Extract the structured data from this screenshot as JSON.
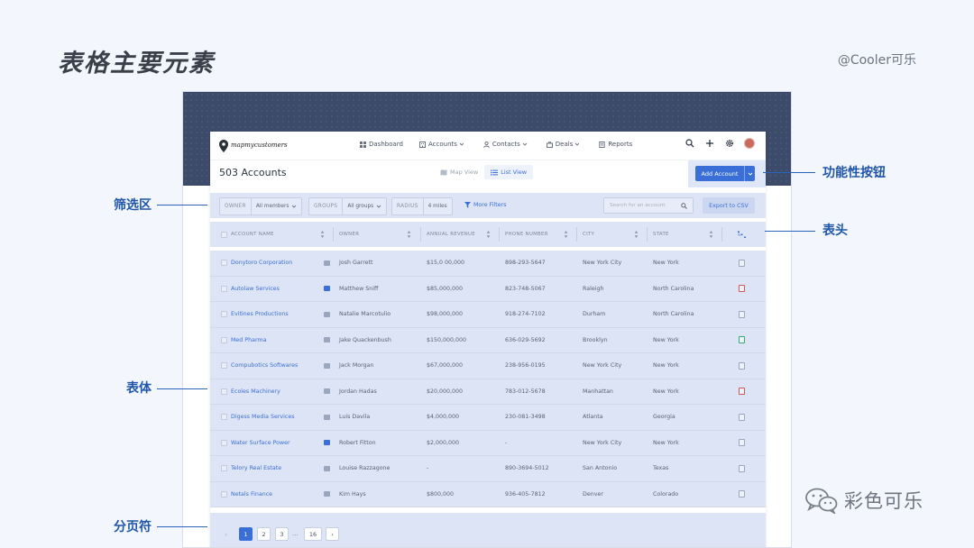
{
  "slide": {
    "title": "表格主要元素",
    "credit": "@Cooler可乐",
    "watermark": "彩色可乐"
  },
  "annotations": {
    "function_buttons": "功能性按钮",
    "filter_area": "筛选区",
    "table_header": "表头",
    "table_body": "表体",
    "pagination": "分页符"
  },
  "app": {
    "logo_text": "mapmycustomers",
    "nav": [
      {
        "label": "Dashboard",
        "icon": "dashboard-icon"
      },
      {
        "label": "Accounts",
        "icon": "building-icon",
        "dropdown": true
      },
      {
        "label": "Contacts",
        "icon": "person-icon",
        "dropdown": true
      },
      {
        "label": "Deals",
        "icon": "briefcase-icon",
        "dropdown": true
      },
      {
        "label": "Reports",
        "icon": "report-icon"
      }
    ],
    "page_title": "503 Accounts",
    "view_toggle": {
      "map": "Map View",
      "list": "List View",
      "active": "list"
    },
    "add_button": "Add Account",
    "accent": "#3b6fd8"
  },
  "filters": {
    "owner": {
      "label": "OWNER",
      "value": "All members"
    },
    "groups": {
      "label": "GROUPS",
      "value": "All groups"
    },
    "radius": {
      "label": "RADIUS",
      "value": "4 miles"
    },
    "more": "More Filters",
    "search_placeholder": "Search for an account",
    "export": "Export to CSV"
  },
  "table": {
    "columns": [
      "ACCOUNT NAME",
      "OWNER",
      "ANNUAL REVENUE",
      "PHONE NUMBER",
      "CITY",
      "STATE"
    ],
    "rows": [
      {
        "name": "Donytoro Corporation",
        "owner": "Josh Garrett",
        "revenue": "$15,0 00,000",
        "phone": "898-293-5647",
        "city": "New York City",
        "state": "New York",
        "tag": "#9aa6bd",
        "status": "#9aa6bd"
      },
      {
        "name": "Autolaw Services",
        "owner": "Matthew Sniff",
        "revenue": "$85,000,000",
        "phone": "823-748-5067",
        "city": "Raleigh",
        "state": "North Carolina",
        "tag": "#3b6fd8",
        "status": "#d9534f"
      },
      {
        "name": "Evitines Productions",
        "owner": "Natalie Marcotulio",
        "revenue": "$98,000,000",
        "phone": "918-274-7102",
        "city": "Durham",
        "state": "North Carolina",
        "tag": "#9aa6bd",
        "status": "#9aa6bd"
      },
      {
        "name": "Med Pharma",
        "owner": "Jake Quackenbush",
        "revenue": "$150,000,000",
        "phone": "636-029-5692",
        "city": "Brooklyn",
        "state": "New York",
        "tag": "#9aa6bd",
        "status": "#2fae6b"
      },
      {
        "name": "Compubotics Softwares",
        "owner": "Jack Morgan",
        "revenue": "$67,000,000",
        "phone": "238-956-0195",
        "city": "New York City",
        "state": "New York",
        "tag": "#9aa6bd",
        "status": "#9aa6bd"
      },
      {
        "name": "Ecoles Machinery",
        "owner": "Jordan Hadas",
        "revenue": "$20,000,000",
        "phone": "783-012-5678",
        "city": "Manhattan",
        "state": "New York",
        "tag": "#9aa6bd",
        "status": "#d9534f"
      },
      {
        "name": "Digess Media Services",
        "owner": "Luis Davila",
        "revenue": "$4,000,000",
        "phone": "230-081-3498",
        "city": "Atlanta",
        "state": "Georgia",
        "tag": "#9aa6bd",
        "status": "#9aa6bd"
      },
      {
        "name": "Water Surface Power",
        "owner": "Robert Fitton",
        "revenue": "$2,000,000",
        "phone": "-",
        "city": "New York City",
        "state": "New York",
        "tag": "#3b6fd8",
        "status": "#9aa6bd"
      },
      {
        "name": "Telory Real Estate",
        "owner": "Louise Razzagone",
        "revenue": "-",
        "phone": "890-3694-5012",
        "city": "San Antonio",
        "state": "Texas",
        "tag": "#9aa6bd",
        "status": "#9aa6bd"
      },
      {
        "name": "Netals Finance",
        "owner": "Kim Hays",
        "revenue": "$800,000",
        "phone": "936-405-7812",
        "city": "Denver",
        "state": "Colorado",
        "tag": "#9aa6bd",
        "status": "#9aa6bd"
      }
    ]
  },
  "pagination": {
    "prev": "‹",
    "pages": [
      "1",
      "2",
      "3"
    ],
    "ellipsis": "...",
    "last": "16",
    "next": "›",
    "current": "1"
  }
}
